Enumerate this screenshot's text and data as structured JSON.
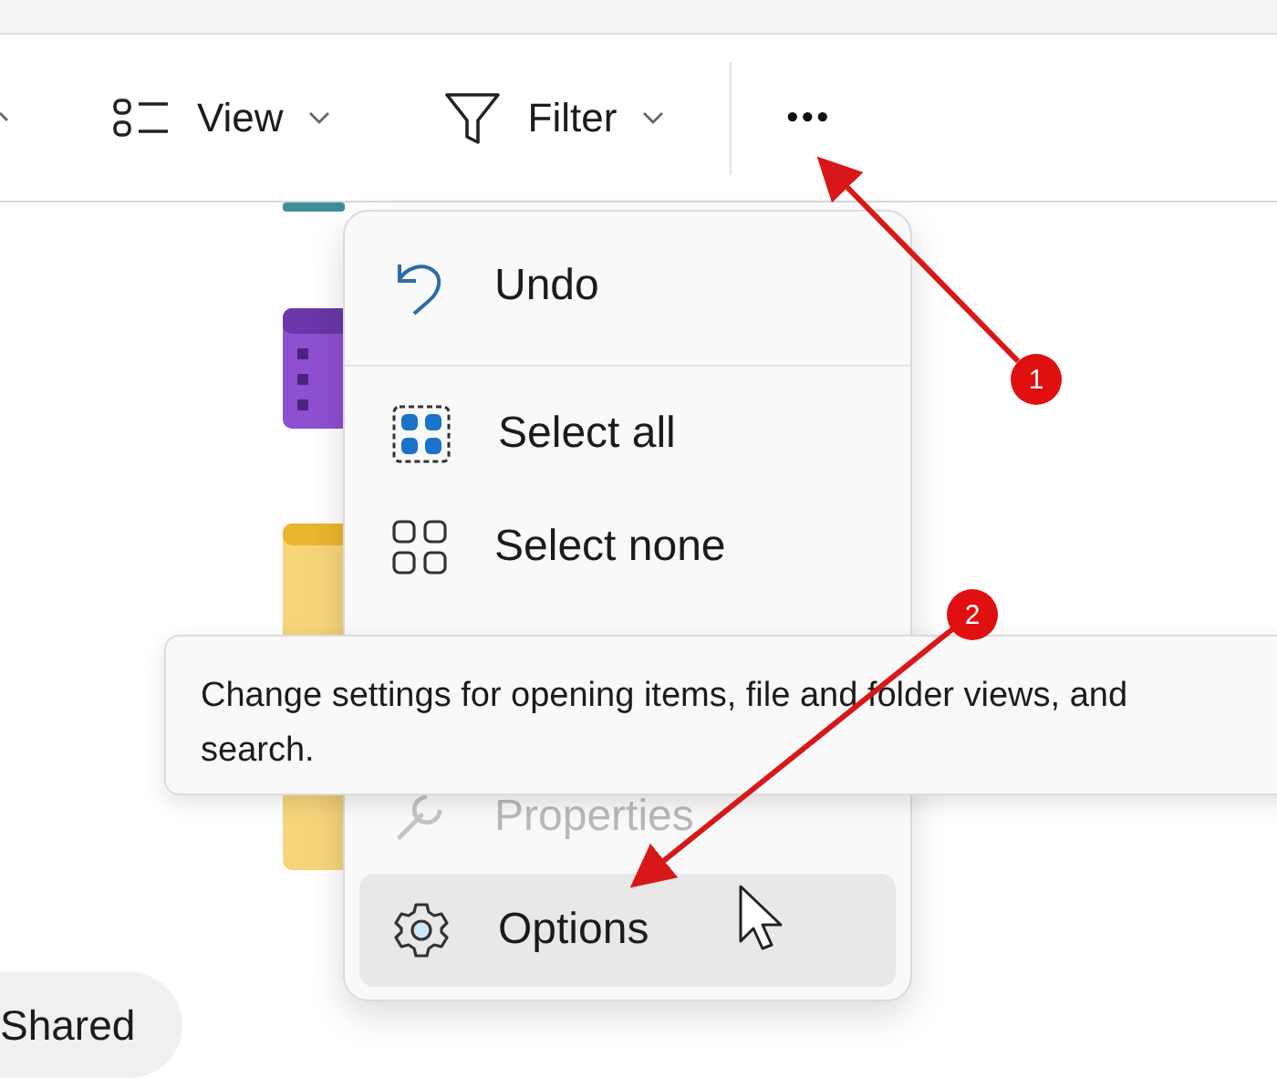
{
  "toolbar": {
    "items": [
      {
        "kind": "view",
        "label": "View"
      },
      {
        "kind": "filter",
        "label": "Filter"
      },
      {
        "kind": "more",
        "label": "•••"
      }
    ]
  },
  "menu": {
    "items": [
      {
        "kind": "undo",
        "label": "Undo",
        "disabled": false,
        "selected": false
      },
      {
        "kind": "separator"
      },
      {
        "kind": "select-all",
        "label": "Select all",
        "disabled": false,
        "selected": false
      },
      {
        "kind": "select-none",
        "label": "Select none",
        "disabled": false,
        "selected": false
      },
      {
        "kind": "hidden"
      },
      {
        "kind": "properties",
        "label": "Properties",
        "disabled": true,
        "selected": false
      },
      {
        "kind": "options",
        "label": "Options",
        "disabled": false,
        "selected": true
      }
    ]
  },
  "tooltip": {
    "text": "Change settings for opening items, file and folder views, and search."
  },
  "sidebar": {
    "items": [
      {
        "label": "Shared"
      }
    ]
  },
  "annotations": [
    {
      "label": "1"
    },
    {
      "label": "2"
    }
  ]
}
